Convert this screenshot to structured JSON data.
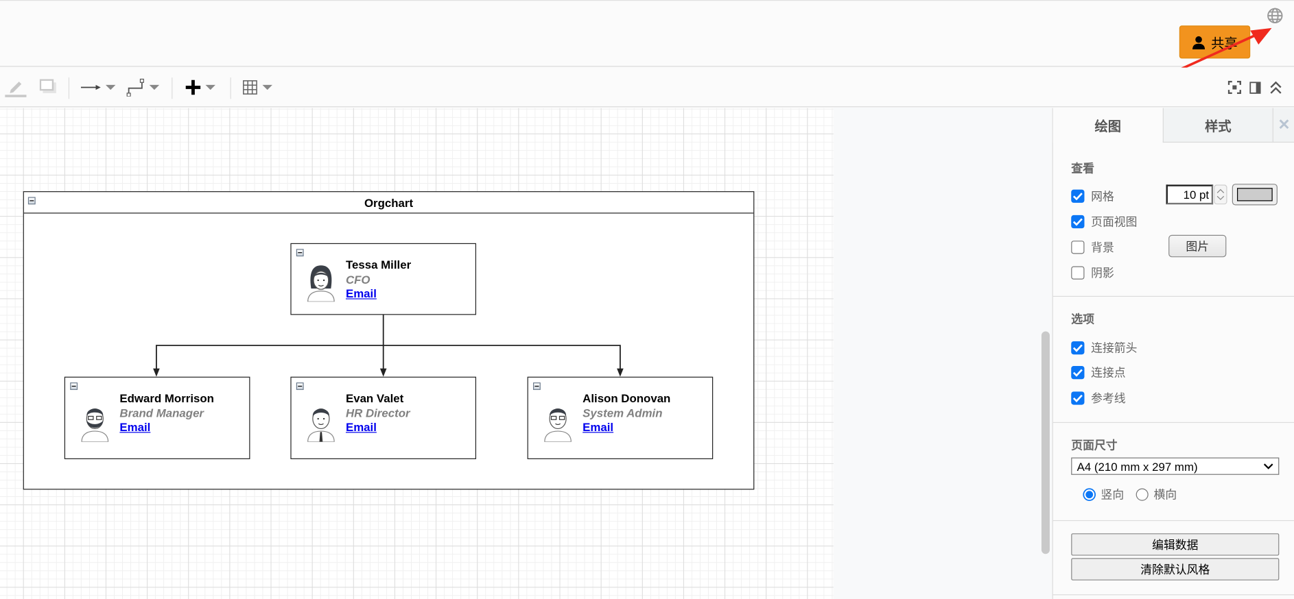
{
  "header": {
    "share_label": "共享",
    "share_color": "#f2931e"
  },
  "toolbar": {
    "icons": [
      "pencil-icon",
      "shadow-icon",
      "arrow-icon",
      "waypoint-icon",
      "plus-icon",
      "table-icon",
      "fullscreen-icon",
      "format-panel-icon",
      "collapse-icon"
    ]
  },
  "diagram": {
    "container_title": "Orgchart",
    "root": {
      "name": "Tessa Miller",
      "role": "CFO",
      "link": "Email"
    },
    "children": [
      {
        "name": "Edward Morrison",
        "role": "Brand Manager",
        "link": "Email"
      },
      {
        "name": "Evan Valet",
        "role": "HR Director",
        "link": "Email"
      },
      {
        "name": "Alison Donovan",
        "role": "System Admin",
        "link": "Email"
      }
    ]
  },
  "panel": {
    "tabs": [
      {
        "label": "绘图",
        "active": true
      },
      {
        "label": "样式",
        "active": false
      }
    ],
    "view": {
      "title": "查看",
      "grid": {
        "label": "网格",
        "checked": true,
        "size": "10 pt",
        "color": "#cccccc"
      },
      "page_view": {
        "label": "页面视图",
        "checked": true
      },
      "background": {
        "label": "背景",
        "checked": false,
        "button": "图片"
      },
      "shadow": {
        "label": "阴影",
        "checked": false
      }
    },
    "options": {
      "title": "选项",
      "items": [
        {
          "label": "连接箭头",
          "checked": true
        },
        {
          "label": "连接点",
          "checked": true
        },
        {
          "label": "参考线",
          "checked": true
        }
      ]
    },
    "page_size": {
      "title": "页面尺寸",
      "selected": "A4 (210 mm x 297 mm)",
      "portrait": "竖向",
      "landscape": "横向",
      "orientation": "portrait"
    },
    "buttons": {
      "edit_data": "编辑数据",
      "clear_style": "清除默认风格"
    }
  }
}
